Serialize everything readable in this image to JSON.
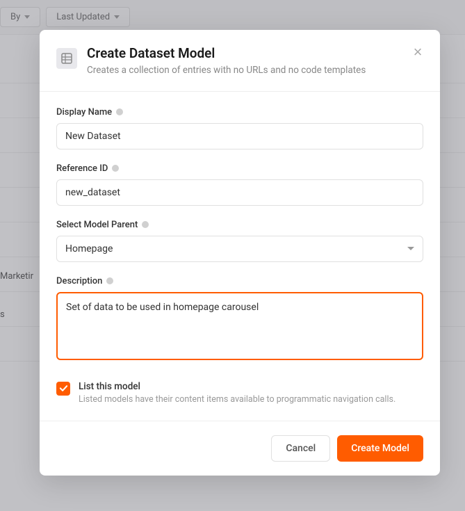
{
  "background": {
    "toolbar": {
      "sort_by": "By",
      "last_updated": "Last Updated"
    },
    "sidebar": {
      "marketing_fragment": "Marketir",
      "item2_fragment": "s"
    }
  },
  "modal": {
    "title": "Create Dataset Model",
    "subtitle": "Creates a collection of entries with no URLs and no code templates",
    "fields": {
      "display_name": {
        "label": "Display Name",
        "value": "New Dataset"
      },
      "reference_id": {
        "label": "Reference ID",
        "value": "new_dataset"
      },
      "parent": {
        "label": "Select Model Parent",
        "value": "Homepage"
      },
      "description": {
        "label": "Description",
        "value": "Set of data to be used in homepage carousel"
      }
    },
    "checkbox": {
      "title": "List this model",
      "description": "Listed models have their content items available to programmatic navigation calls."
    },
    "buttons": {
      "cancel": "Cancel",
      "create": "Create Model"
    }
  }
}
